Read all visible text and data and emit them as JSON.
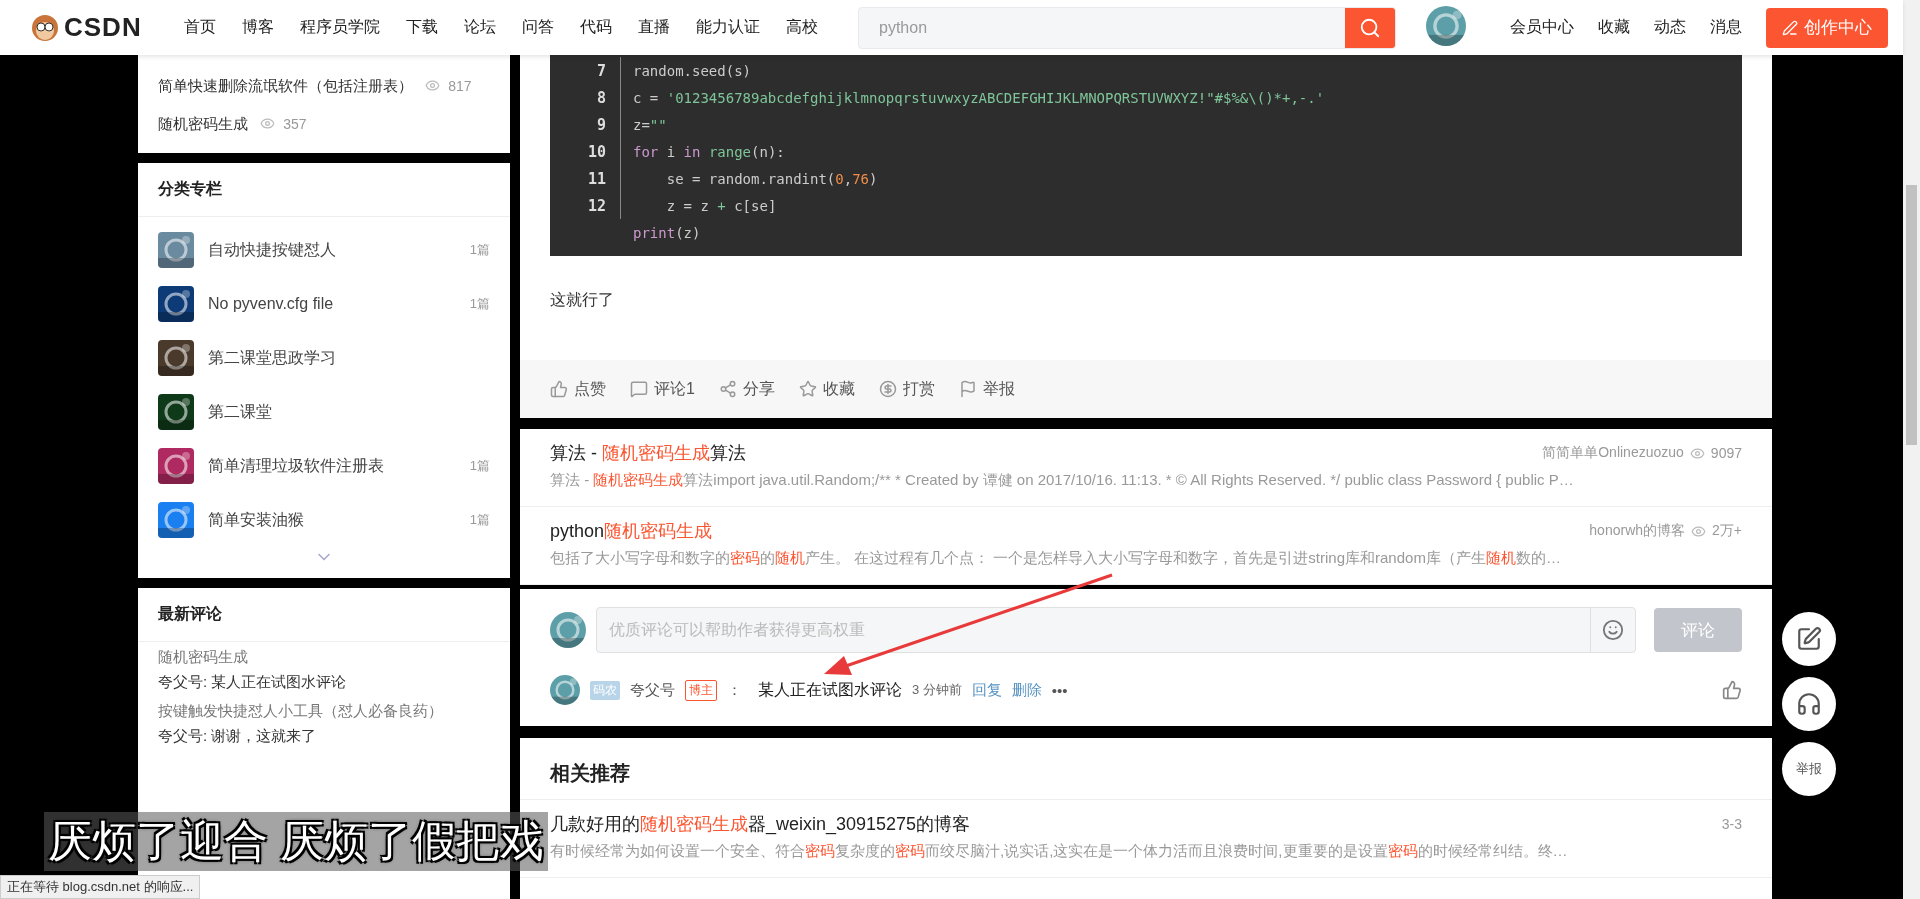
{
  "header": {
    "logo": "CSDN",
    "nav": [
      {
        "label": "首页"
      },
      {
        "label": "博客"
      },
      {
        "label": "程序员学院"
      },
      {
        "label": "下载"
      },
      {
        "label": "论坛"
      },
      {
        "label": "问答"
      },
      {
        "label": "代码"
      },
      {
        "label": "直播"
      },
      {
        "label": "能力认证"
      },
      {
        "label": "高校"
      }
    ],
    "search": {
      "placeholder": "python"
    },
    "links": [
      {
        "label": "会员中心"
      },
      {
        "label": "收藏"
      },
      {
        "label": "动态"
      },
      {
        "label": "消息"
      }
    ],
    "create_button": "创作中心"
  },
  "sidebar": {
    "hot_articles": [
      {
        "title": "简单快速删除流氓软件（包括注册表）",
        "views": "817"
      },
      {
        "title": "随机密码生成",
        "views": "357"
      }
    ],
    "columns_title": "分类专栏",
    "columns": [
      {
        "name": "自动快捷按键怼人",
        "count": "1篇",
        "color": "#6a8aa0"
      },
      {
        "name": "No pyvenv.cfg file",
        "count": "1篇",
        "color": "#0d3b78"
      },
      {
        "name": "第二课堂思政学习",
        "color": "#4a3a2c"
      },
      {
        "name": "第二课堂",
        "color": "#0f3a1a"
      },
      {
        "name": "简单清理垃圾软件注册表",
        "count": "1篇",
        "color": "#b02a62"
      },
      {
        "name": "简单安装油猴",
        "count": "1篇",
        "color": "#1a7ff0"
      }
    ],
    "recent_title": "最新评论",
    "recent": [
      {
        "article": "随机密码生成",
        "comment": "夸父号: 某人正在试图水评论"
      },
      {
        "article": "按键触发快捷怼人小工具（怼人必备良药）",
        "comment": "夸父号: 谢谢，这就来了"
      }
    ]
  },
  "article": {
    "code": [
      {
        "no": "7",
        "tokens": [
          {
            "kind": "plain",
            "text": "random.seed(s)"
          }
        ]
      },
      {
        "no": "8",
        "tokens": [
          {
            "kind": "plain",
            "text": "c = "
          },
          {
            "kind": "string",
            "text": "'0123456789abcdefghijklmnopqrstuvwxyzABCDEFGHIJKLMNOPQRSTUVWXYZ!\"#$%&\\()*+,-.'"
          }
        ]
      },
      {
        "no": "9",
        "tokens": [
          {
            "kind": "plain",
            "text": "z="
          },
          {
            "kind": "string",
            "text": "\"\""
          }
        ]
      },
      {
        "no": "10",
        "tokens": [
          {
            "kind": "keyword",
            "text": "for"
          },
          {
            "kind": "plain",
            "text": " i "
          },
          {
            "kind": "keyword",
            "text": "in"
          },
          {
            "kind": "builtin",
            "text": " range"
          },
          {
            "kind": "plain",
            "text": "(n):"
          }
        ]
      },
      {
        "no": "11",
        "tokens": [
          {
            "kind": "plain",
            "text": "    se = random.randint("
          },
          {
            "kind": "number",
            "text": "0"
          },
          {
            "kind": "plain",
            "text": ","
          },
          {
            "kind": "number",
            "text": "76"
          },
          {
            "kind": "plain",
            "text": ")"
          }
        ]
      },
      {
        "no": "12",
        "tokens": [
          {
            "kind": "plain",
            "text": "    z = z "
          },
          {
            "kind": "builtin",
            "text": "+"
          },
          {
            "kind": "plain",
            "text": " c[se]"
          }
        ]
      },
      {
        "tokens": [
          {
            "kind": "keyword",
            "text": "print"
          },
          {
            "kind": "plain",
            "text": "(z)"
          }
        ]
      }
    ],
    "text": "这就行了",
    "actions": [
      {
        "kind": "like",
        "label": "点赞"
      },
      {
        "kind": "comment",
        "label": "评论1"
      },
      {
        "kind": "share",
        "label": "分享"
      },
      {
        "kind": "star",
        "label": "收藏"
      },
      {
        "kind": "reward",
        "label": "打赏"
      },
      {
        "kind": "flag",
        "label": "举报"
      }
    ]
  },
  "related": [
    {
      "title": [
        {
          "text": "算法 - ",
          "hl": false
        },
        {
          "text": "随机密码生成",
          "hl": true
        },
        {
          "text": "算法",
          "hl": false
        }
      ],
      "author": "简简单单Onlinezuozuo",
      "views": "9097",
      "desc": [
        {
          "text": "算法 - ",
          "hl": false
        },
        {
          "text": "随机密码生成",
          "hl": true
        },
        {
          "text": "算法import java.util.Random;/** * Created by 谭健 on 2017/10/16. 11:13. * © All Rights Reserved. */ public class Password { public P…",
          "hl": false
        }
      ]
    },
    {
      "title": [
        {
          "text": "python",
          "hl": false
        },
        {
          "text": "随机密码生成",
          "hl": true
        }
      ],
      "author": "honorwh的博客",
      "views": "2万+",
      "desc": [
        {
          "text": "包括了大小写字母和数字的",
          "hl": false
        },
        {
          "text": "密码",
          "hl": true
        },
        {
          "text": "的",
          "hl": false
        },
        {
          "text": "随机",
          "hl": true
        },
        {
          "text": "产生。 在这过程有几个点： 一个是怎样导入大小写字母和数字，首先是引进string库和random库（产生",
          "hl": false
        },
        {
          "text": "随机",
          "hl": true
        },
        {
          "text": "数的…",
          "hl": false
        }
      ]
    }
  ],
  "comments": {
    "placeholder": "优质评论可以帮助作者获得更高权重",
    "submit": "评论",
    "items": [
      {
        "badge": "码农",
        "author": "夸父号",
        "role": "博主",
        "separator": "：",
        "text": "某人正在试图水评论",
        "time": "3 分钟前",
        "reply": "回复",
        "delete": "删除",
        "more": "•••"
      }
    ]
  },
  "recommend": {
    "title": "相关推荐",
    "items": [
      {
        "title": [
          {
            "text": "几款好用的",
            "hl": false
          },
          {
            "text": "随机密码生成",
            "hl": true
          },
          {
            "text": "器_weixin_30915275的博客",
            "hl": false
          }
        ],
        "date": "3-3",
        "desc": [
          {
            "text": "有时候经常为如何设置一个安全、符合",
            "hl": false
          },
          {
            "text": "密码",
            "hl": true
          },
          {
            "text": "复杂度的",
            "hl": false
          },
          {
            "text": "密码",
            "hl": true
          },
          {
            "text": "而绞尽脑汁,说实话,这实在是一个体力活而且浪费时间,更重要的是设置",
            "hl": false
          },
          {
            "text": "密码",
            "hl": true
          },
          {
            "text": "的时候经常纠结。终…",
            "hl": false
          }
        ]
      }
    ]
  },
  "float_buttons": [
    {
      "kind": "edit"
    },
    {
      "kind": "support"
    },
    {
      "kind": "text",
      "label": "举报"
    }
  ],
  "caption": "厌烦了迎合 厌烦了假把戏",
  "status_bar": "正在等待 blog.csdn.net 的响应..."
}
